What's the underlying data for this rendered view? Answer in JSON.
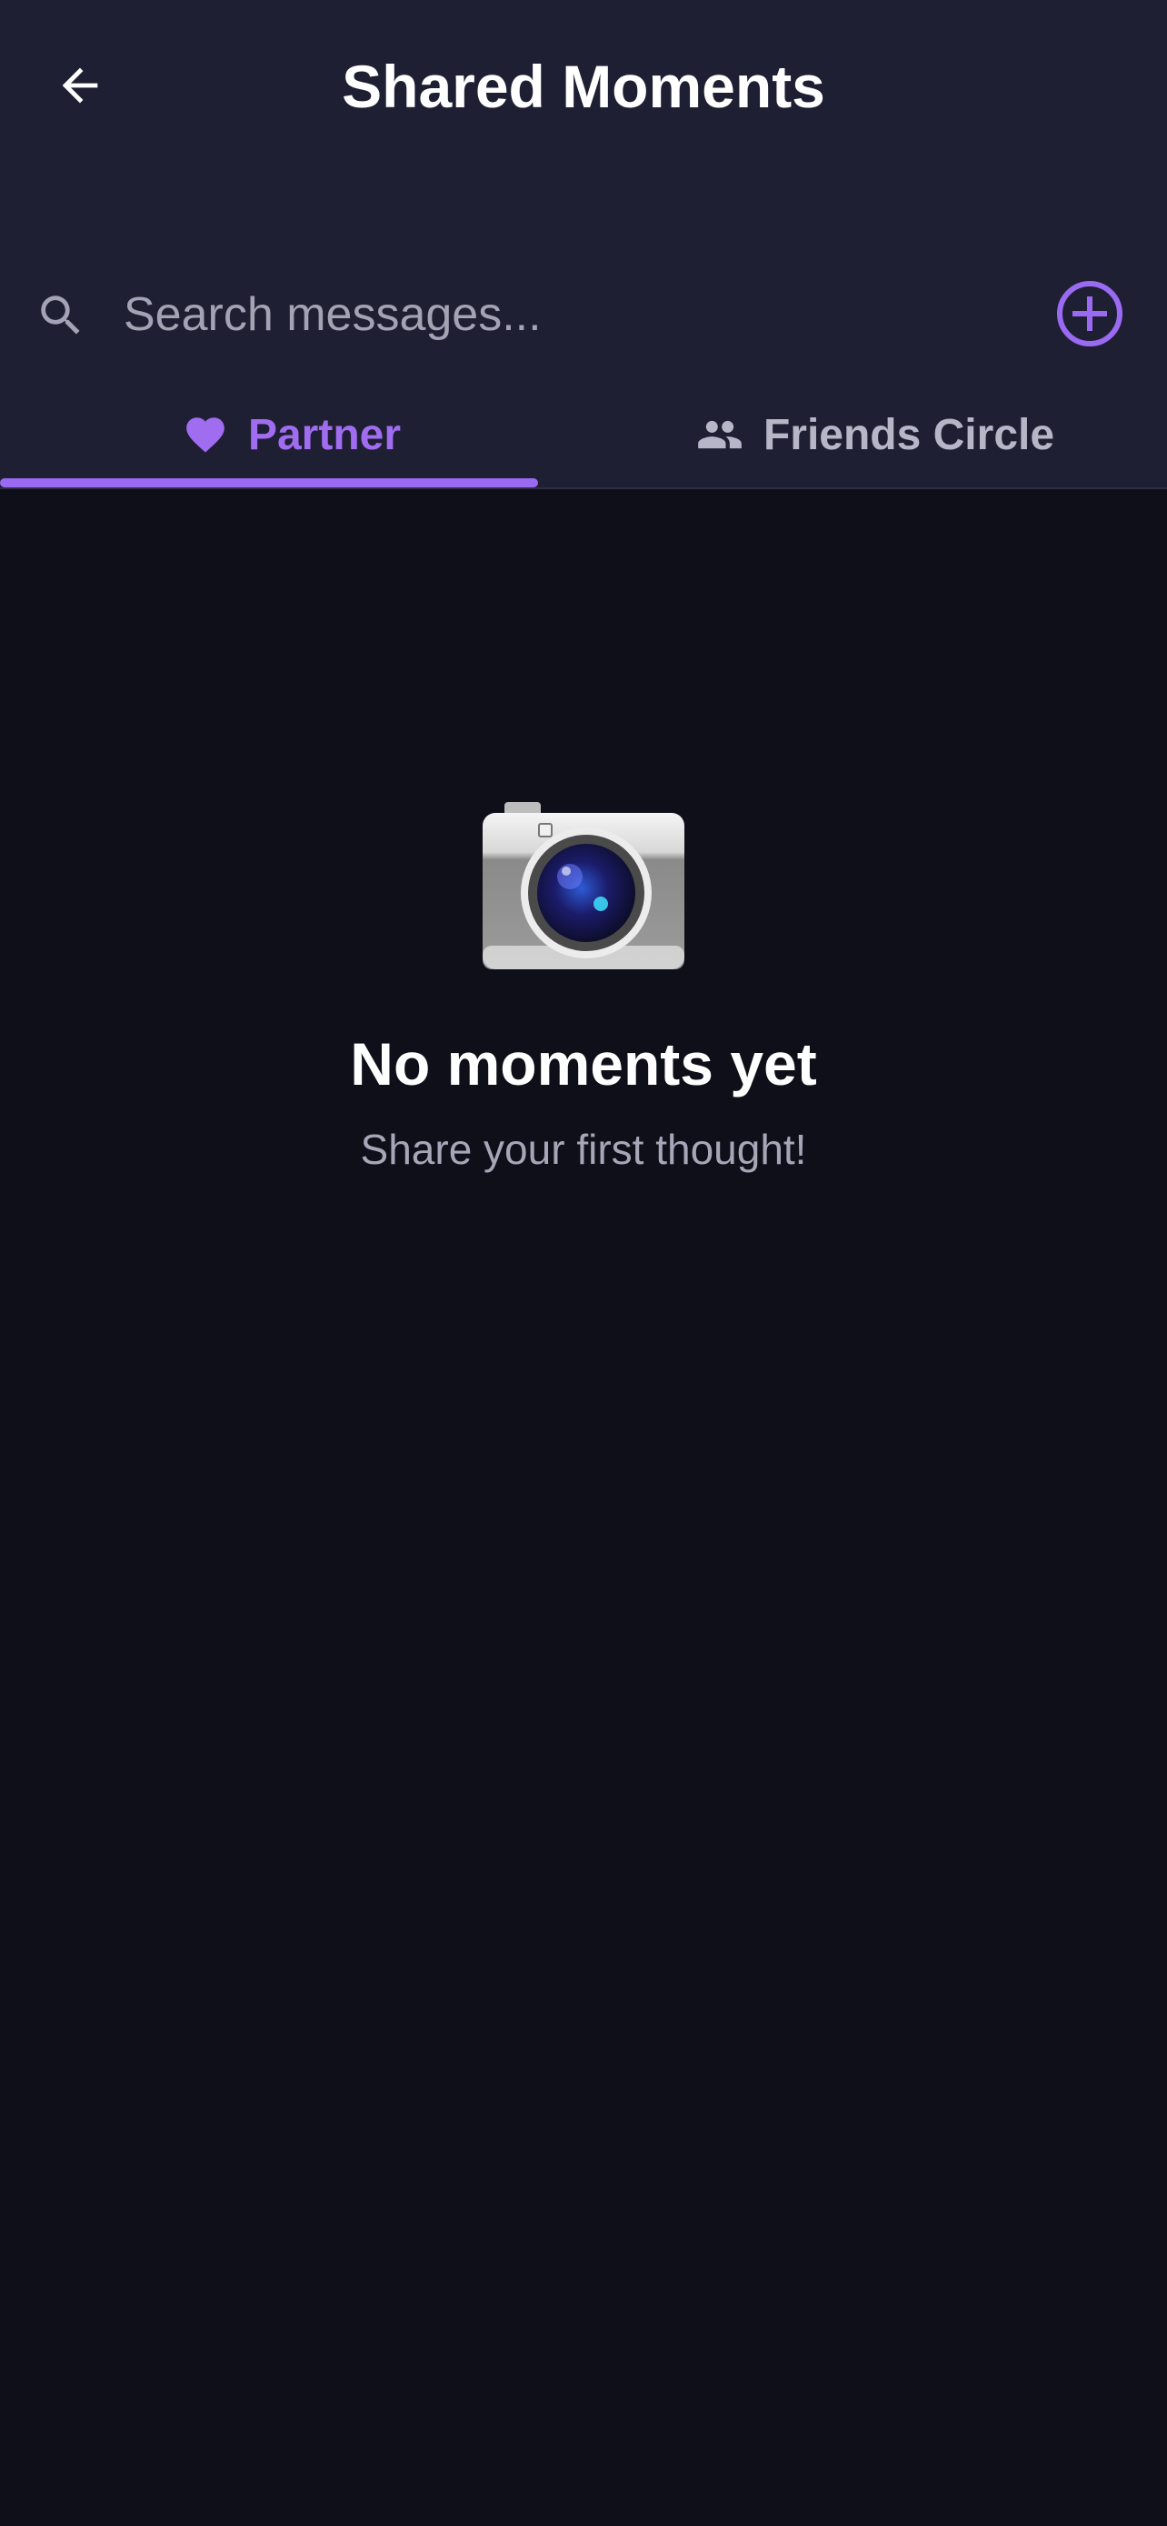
{
  "header": {
    "title": "Shared Moments"
  },
  "search": {
    "placeholder": "Search messages...",
    "value": ""
  },
  "tabs": [
    {
      "label": "Partner",
      "icon": "heart-icon",
      "active": true
    },
    {
      "label": "Friends Circle",
      "icon": "people-icon",
      "active": false
    }
  ],
  "empty_state": {
    "icon": "camera-icon",
    "title": "No moments yet",
    "subtitle": "Share your first thought!"
  },
  "colors": {
    "background": "#0f0f19",
    "header_background": "#1f1f33",
    "accent": "#9a6af2",
    "inactive_tab": "#b6b6c6"
  }
}
